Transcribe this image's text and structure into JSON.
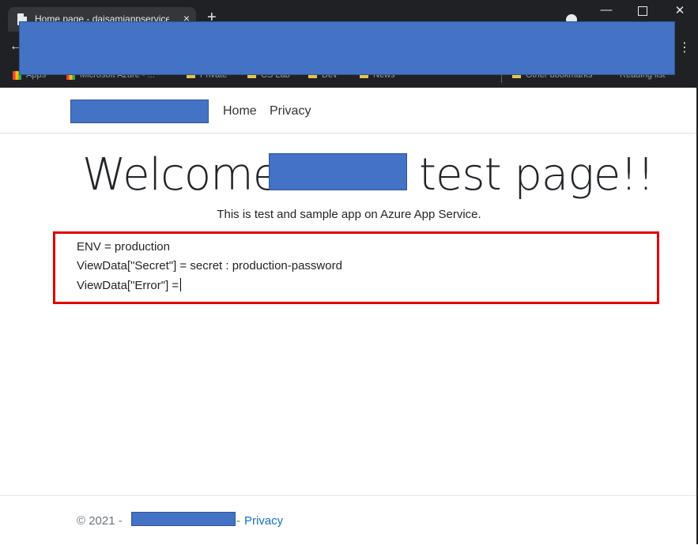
{
  "browser": {
    "tab_title": "Home page - daisamiappservice",
    "tab_close": "×",
    "new_tab": "+",
    "back": "←",
    "menu": "⋮",
    "window_min": "—",
    "window_close": "✕",
    "bookmarks": {
      "apps": "Apps",
      "item1": "Microsoft Azure - ...",
      "item2": "Private",
      "item3": "CS Lab",
      "item4": "Dev",
      "item5": "News",
      "other": "Other bookmarks",
      "reading": "Reading list"
    }
  },
  "navbar": {
    "home": "Home",
    "privacy": "Privacy"
  },
  "main": {
    "welcome_start": "Welcome",
    "welcome_end": "test page!!",
    "subtitle": "This is test and sample app on Azure App Service.",
    "env_line": "ENV = production",
    "secret_line": "ViewData[\"Secret\"] = secret : production-password",
    "error_line": "ViewData[\"Error\"] ="
  },
  "footer": {
    "copyright": "© 2021 -",
    "dash": "-",
    "privacy": "Privacy"
  },
  "colors": {
    "redaction": "#4472c4",
    "highlight": "#e00000",
    "link": "#1b6ec2"
  }
}
